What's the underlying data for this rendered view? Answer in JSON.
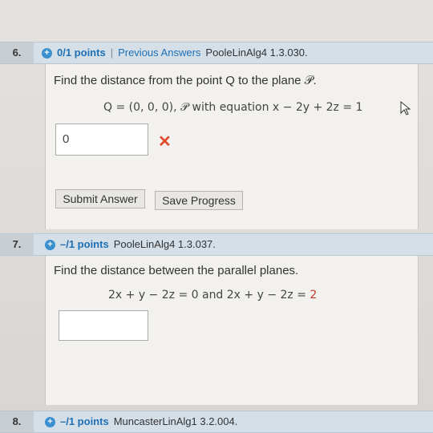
{
  "q6": {
    "number": "6.",
    "points": "0/1 points",
    "separator": "|",
    "previous": "Previous Answers",
    "source": "PooleLinAlg4 1.3.030.",
    "prompt": "Find the distance from the point Q to the plane 𝒫.",
    "math": "Q = (0, 0, 0), 𝒫 with equation  x − 2y + 2z = 1",
    "answer_value": "0",
    "status_icon": "x-mark-icon",
    "submit_label": "Submit Answer",
    "save_label": "Save Progress"
  },
  "q7": {
    "number": "7.",
    "points": "–/1 points",
    "source": "PooleLinAlg4 1.3.037.",
    "prompt": "Find the distance between the parallel planes.",
    "math_left": "2x + y − 2z = 0  and  2x + y − 2z = ",
    "math_rhs": "2",
    "answer_value": ""
  },
  "q8": {
    "number": "8.",
    "points": "–/1 points",
    "source": "MuncasterLinAlg1 3.2.004."
  },
  "colors": {
    "accent": "#1f6fb5",
    "header_bg": "#d4dfe8",
    "wrong": "#e04a2d"
  }
}
